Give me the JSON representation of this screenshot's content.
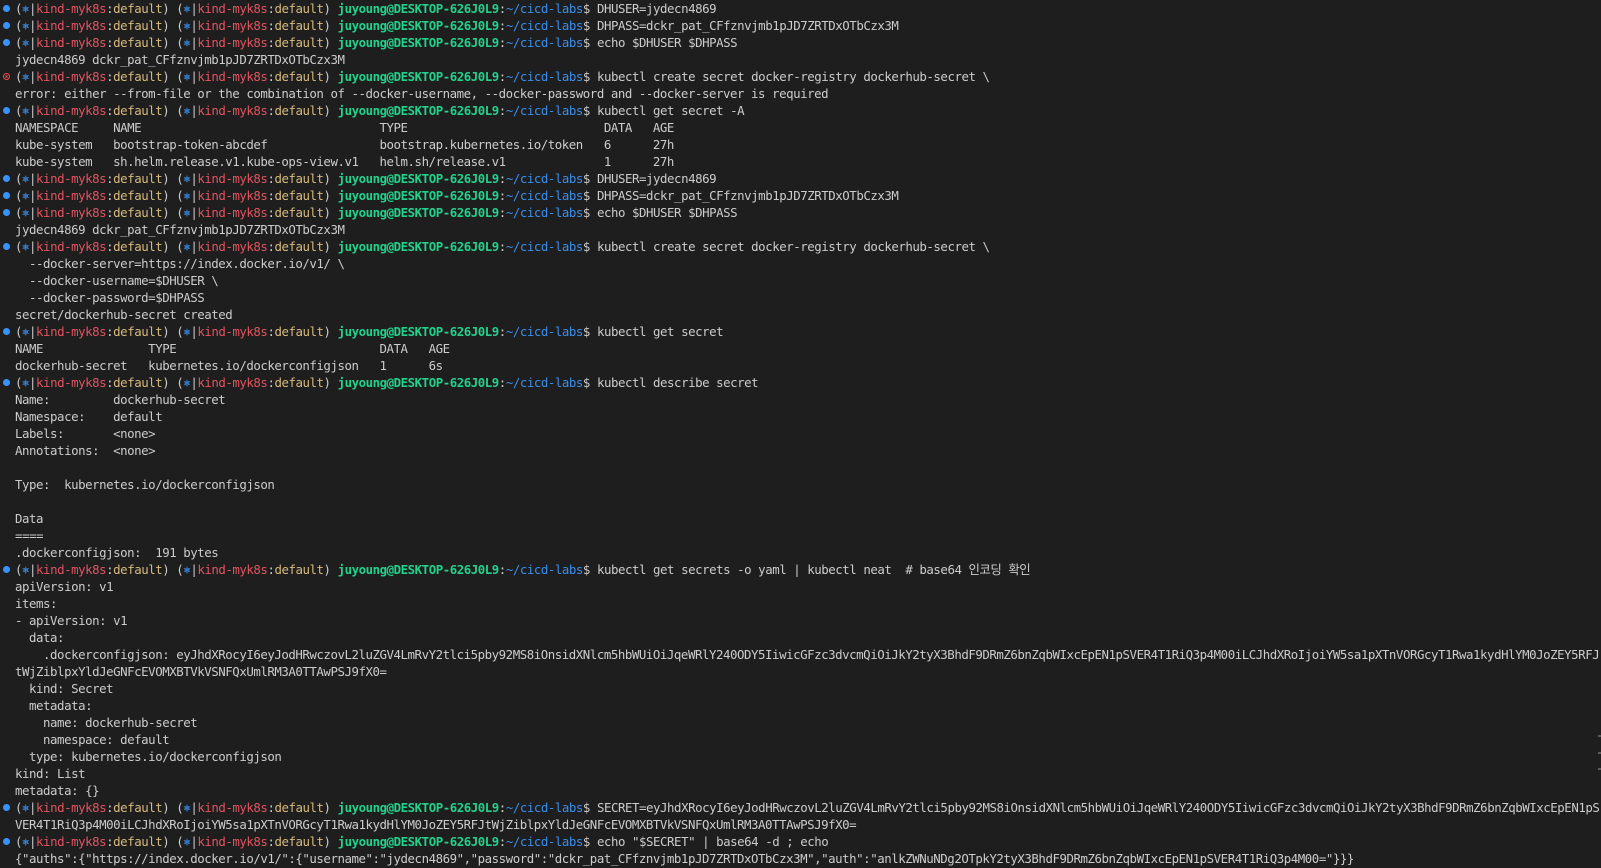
{
  "prompt": {
    "open": "(",
    "k8s_icon": "⎈",
    "bar": "|",
    "context": "kind-myk8s",
    "colon": ":",
    "namespace": "default",
    "close": ")",
    "user_host": "juyoung@DESKTOP-626J0L9",
    "path_sep": ":",
    "path": "~/cicd-labs",
    "dollar": "$"
  },
  "lines": [
    {
      "type": "prompt",
      "status": "ok",
      "command": "DHUSER=jydecn4869"
    },
    {
      "type": "prompt",
      "status": "ok",
      "command": "DHPASS=dckr_pat_CFfznvjmb1pJD7ZRTDxOTbCzx3M"
    },
    {
      "type": "prompt",
      "status": "ok",
      "command": "echo $DHUSER $DHPASS"
    },
    {
      "type": "output",
      "text": "jydecn4869 dckr_pat_CFfznvjmb1pJD7ZRTDxOTbCzx3M"
    },
    {
      "type": "prompt",
      "status": "err",
      "command": "kubectl create secret docker-registry dockerhub-secret \\"
    },
    {
      "type": "output",
      "text": "error: either --from-file or the combination of --docker-username, --docker-password and --docker-server is required"
    },
    {
      "type": "prompt",
      "status": "ok",
      "command": "kubectl get secret -A"
    },
    {
      "type": "output",
      "text": "NAMESPACE     NAME                                  TYPE                            DATA   AGE"
    },
    {
      "type": "output",
      "text": "kube-system   bootstrap-token-abcdef                bootstrap.kubernetes.io/token   6      27h"
    },
    {
      "type": "output",
      "text": "kube-system   sh.helm.release.v1.kube-ops-view.v1   helm.sh/release.v1              1      27h"
    },
    {
      "type": "prompt",
      "status": "ok",
      "command": "DHUSER=jydecn4869"
    },
    {
      "type": "prompt",
      "status": "ok",
      "command": "DHPASS=dckr_pat_CFfznvjmb1pJD7ZRTDxOTbCzx3M"
    },
    {
      "type": "prompt",
      "status": "ok",
      "command": "echo $DHUSER $DHPASS"
    },
    {
      "type": "output",
      "text": "jydecn4869 dckr_pat_CFfznvjmb1pJD7ZRTDxOTbCzx3M"
    },
    {
      "type": "prompt",
      "status": "ok",
      "command": "kubectl create secret docker-registry dockerhub-secret \\"
    },
    {
      "type": "output",
      "text": "  --docker-server=https://index.docker.io/v1/ \\"
    },
    {
      "type": "output",
      "text": "  --docker-username=$DHUSER \\"
    },
    {
      "type": "output",
      "text": "  --docker-password=$DHPASS"
    },
    {
      "type": "output",
      "text": "secret/dockerhub-secret created"
    },
    {
      "type": "prompt",
      "status": "ok",
      "command": "kubectl get secret"
    },
    {
      "type": "output",
      "text": "NAME               TYPE                             DATA   AGE"
    },
    {
      "type": "output",
      "text": "dockerhub-secret   kubernetes.io/dockerconfigjson   1      6s"
    },
    {
      "type": "prompt",
      "status": "ok",
      "command": "kubectl describe secret"
    },
    {
      "type": "output",
      "text": "Name:         dockerhub-secret"
    },
    {
      "type": "output",
      "text": "Namespace:    default"
    },
    {
      "type": "output",
      "text": "Labels:       <none>"
    },
    {
      "type": "output",
      "text": "Annotations:  <none>"
    },
    {
      "type": "output",
      "text": ""
    },
    {
      "type": "output",
      "text": "Type:  kubernetes.io/dockerconfigjson"
    },
    {
      "type": "output",
      "text": ""
    },
    {
      "type": "output",
      "text": "Data"
    },
    {
      "type": "output",
      "text": "===="
    },
    {
      "type": "output",
      "text": ".dockerconfigjson:  191 bytes"
    },
    {
      "type": "prompt",
      "status": "ok",
      "command": "kubectl get secrets -o yaml | kubectl neat  # base64 인코딩 확인"
    },
    {
      "type": "output",
      "text": "apiVersion: v1"
    },
    {
      "type": "output",
      "text": "items:"
    },
    {
      "type": "output",
      "text": "- apiVersion: v1"
    },
    {
      "type": "output",
      "text": "  data:"
    },
    {
      "type": "output",
      "text": "    .dockerconfigjson: eyJhdXRocyI6eyJodHRwczovL2luZGV4LmRvY2tlci5pby92MS8iOnsidXNlcm5hbWUiOiJqeWRlY240ODY5IiwicGFzc3dvcmQiOiJkY2tyX3BhdF9DRmZ6bnZqbWIxcEpEN1pSVER4T1RiQ3p4M00iLCJhdXRoIjoiYW5sa1pXTnVORGcyT1Rwa1kydHlYM0JoZEY5RFJ"
    },
    {
      "type": "output",
      "text": "tWjZiblpxYldJeGNFcEVOMXBTVkVSNFQxUmlRM3A0TTAwPSJ9fX0="
    },
    {
      "type": "output",
      "text": "  kind: Secret"
    },
    {
      "type": "output",
      "text": "  metadata:"
    },
    {
      "type": "output",
      "text": "    name: dockerhub-secret"
    },
    {
      "type": "output",
      "text": "    namespace: default"
    },
    {
      "type": "output",
      "text": "  type: kubernetes.io/dockerconfigjson"
    },
    {
      "type": "output",
      "text": "kind: List"
    },
    {
      "type": "output",
      "text": "metadata: {}"
    },
    {
      "type": "prompt",
      "status": "ok",
      "command": "SECRET=eyJhdXRocyI6eyJodHRwczovL2luZGV4LmRvY2tlci5pby92MS8iOnsidXNlcm5hbWUiOiJqeWRlY240ODY5IiwicGFzc3dvcmQiOiJkY2tyX3BhdF9DRmZ6bnZqbWIxcEpEN1pS"
    },
    {
      "type": "output",
      "text": "VER4T1RiQ3p4M00iLCJhdXRoIjoiYW5sa1pXTnVORGcyT1Rwa1kydHlYM0JoZEY5RFJtWjZiblpxYldJeGNFcEVOMXBTVkVSNFQxUmlRM3A0TTAwPSJ9fX0="
    },
    {
      "type": "prompt",
      "status": "ok",
      "command": "echo \"$SECRET\" | base64 -d ; echo"
    },
    {
      "type": "output",
      "text": "{\"auths\":{\"https://index.docker.io/v1/\":{\"username\":\"jydecn4869\",\"password\":\"dckr_pat_CFfznvjmb1pJD7ZRTDxOTbCzx3M\",\"auth\":\"anlkZWNuNDg2OTpkY2tyX3BhdF9DRmZ6bnZqbWIxcEpEN1pSVER4T1RiQ3p4M00=\"}}}"
    }
  ]
}
